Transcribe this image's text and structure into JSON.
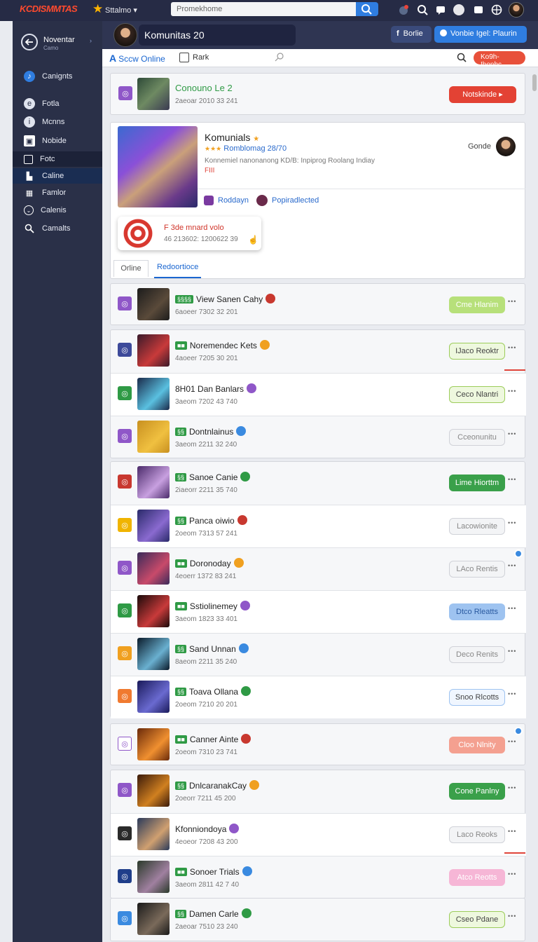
{
  "topbar": {
    "logo": "KCDISMMTAS",
    "menu_label": "Sttalmo ▾",
    "search_value": "Promekhome"
  },
  "sidebar": {
    "title": "Noventar",
    "subtitle": "Camo",
    "items": [
      {
        "label": "Canignts",
        "icon": "music-icon"
      },
      {
        "label": "Fotla",
        "icon": "circle-icon"
      },
      {
        "label": "Mcnns",
        "icon": "info-icon"
      },
      {
        "label": "Nobide",
        "icon": "box-icon"
      },
      {
        "label": "Fotc",
        "icon": "square-icon"
      },
      {
        "label": "Caline",
        "icon": "folder-icon"
      },
      {
        "label": "Famlor",
        "icon": "grid-icon"
      },
      {
        "label": "Calenis",
        "icon": "circle-check-icon"
      },
      {
        "label": "Camalts",
        "icon": "search-icon"
      }
    ]
  },
  "header": {
    "title": "Komunitas 20",
    "btn_facebook": "Borlie",
    "btn_primary": "Vonbie Igel: Plaurin"
  },
  "tabbar": {
    "online": "Sccw Online",
    "rank": "Rark",
    "add_button": "Ko9h-Ihonhc"
  },
  "promo": {
    "title": "Conouno Le 2",
    "meta": "2aeoar 2010 33 241",
    "button": "Notskinde"
  },
  "profile": {
    "name": "Komunials",
    "rank_line": "Romblomag 28/70",
    "desc": "Konnemiel nanonanong KD/B: Inpiprog Roolang Indiay",
    "code": "FIII",
    "right_label": "Gonde",
    "tag1": "Roddayn",
    "tag2": "Popiradlected",
    "card_title": "F 3de mnard volo",
    "card_meta": "46 213602: 1200622 39",
    "tab_online": "Orline",
    "tab_active": "Redoortioce"
  },
  "groups": [
    {
      "rows": [
        {
          "title": "View Sanen Cahy",
          "meta": "6aoeer 7302 32 201",
          "button": "Cme Hlanim",
          "badge": "§§§§",
          "btn_style": "lime",
          "icon_color": "#8f57c8"
        }
      ]
    },
    {
      "rows": [
        {
          "title": "Noremendec Kets",
          "meta": "4aoeer 7205 30 201",
          "button": "IJaco Reoktr",
          "badge": "■■",
          "btn_style": "lime-outline",
          "icon_color": "#3d4a9a"
        },
        {
          "title": "8H01 Dan Banlars",
          "meta": "3aeom 7202 43 740",
          "button": "Ceco Nlantri",
          "badge": "",
          "btn_style": "lime-outline",
          "icon_color": "#2f9a45"
        },
        {
          "title": "Dontnlainus",
          "meta": "3aeom 2211 32 240",
          "button": "Cceonunitu",
          "badge": "§§",
          "btn_style": "grey",
          "icon_color": "#8f57c8"
        }
      ]
    },
    {
      "rows": [
        {
          "title": "Sanoe Canie",
          "meta": "2iaeorr 2211 35 740",
          "button": "Lime Hiorttm",
          "badge": "§§",
          "btn_style": "green",
          "icon_color": "#c8382f"
        },
        {
          "title": "Panca oiwio",
          "meta": "2oeom 7313 57 241",
          "button": "Lacowionite",
          "badge": "§§",
          "btn_style": "grey",
          "icon_color": "#f0b400"
        },
        {
          "title": "Doronoday",
          "meta": "4eoerr 1372 83 241",
          "button": "LAco Rentis",
          "badge": "■■",
          "btn_style": "grey",
          "icon_color": "#8f57c8"
        },
        {
          "title": "Sstiolinemey",
          "meta": "3aeom 1823 33 401",
          "button": "Dtco Rleatts",
          "badge": "■■",
          "btn_style": "blue",
          "icon_color": "#2f9a45"
        },
        {
          "title": "Sand Unnan",
          "meta": "8aeom 2211 35 240",
          "button": "Deco Renits",
          "badge": "§§",
          "btn_style": "grey",
          "icon_color": "#f0a020"
        },
        {
          "title": "Toava Ollana",
          "meta": "2oeom 7210 20 201",
          "button": "Snoo Rlcotts",
          "badge": "§§",
          "btn_style": "lightblue",
          "icon_color": "#f07a30"
        }
      ]
    },
    {
      "rows": [
        {
          "title": "Canner Ainte",
          "meta": "2oeom 7310 23 741",
          "button": "Cloo Nlnity",
          "badge": "■■",
          "btn_style": "salmon",
          "icon_color": "#ffffff"
        }
      ]
    },
    {
      "rows": [
        {
          "title": "DnlcaranakCay",
          "meta": "2oeorr 7211 45 200",
          "button": "Cone Panlny",
          "badge": "§§",
          "btn_style": "green",
          "icon_color": "#8f57c8"
        },
        {
          "title": "Kfonniondoya",
          "meta": "4eoeor 7208 43 200",
          "button": "Laco Reoks",
          "badge": "",
          "btn_style": "grey",
          "icon_color": "#2a2a2a"
        },
        {
          "title": "Sonoer Trials",
          "meta": "3aeom 2811 42 7 40",
          "button": "Atco Reotts",
          "badge": "■■",
          "btn_style": "pink",
          "icon_color": "#1f3e8a"
        }
      ]
    },
    {
      "rows": [
        {
          "title": "Damen Carle",
          "meta": "2aeoar 7510 23 240",
          "button": "Cseo Pdane",
          "badge": "§§",
          "btn_style": "lime-outline",
          "icon_color": "#3a8ae0"
        }
      ]
    }
  ]
}
